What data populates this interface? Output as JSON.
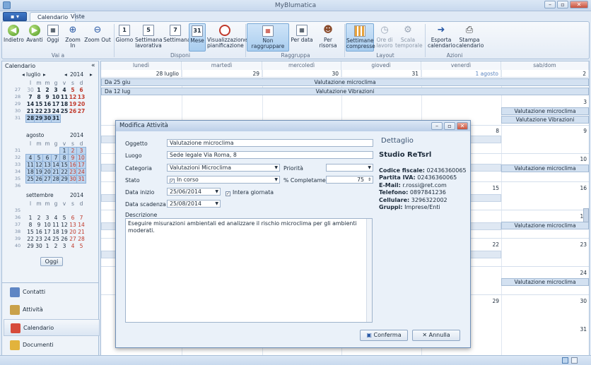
{
  "app": {
    "title": "MyBlumatica"
  },
  "tabs": {
    "file": "▪ ▾",
    "calendario": "Calendario",
    "viste": "Viste"
  },
  "ribbon": {
    "buttons": [
      {
        "label": "Indietro",
        "icon": "arrow-left-icon"
      },
      {
        "label": "Avanti",
        "icon": "arrow-right-icon"
      },
      {
        "label": "Oggi",
        "icon": "today-icon"
      },
      {
        "label": "Zoom In",
        "icon": "zoom-in-icon"
      },
      {
        "label": "Zoom Out",
        "icon": "zoom-out-icon"
      },
      {
        "label": "Giorno",
        "icon": "calendar-day-icon",
        "num": "1"
      },
      {
        "label": "Settimana lavorativa",
        "icon": "calendar-workweek-icon",
        "num": "5"
      },
      {
        "label": "Settimana",
        "icon": "calendar-week-icon",
        "num": "7"
      },
      {
        "label": "Mese",
        "icon": "calendar-month-icon",
        "num": "31"
      },
      {
        "label": "Visualizzazione pianificazione",
        "icon": "timeline-icon"
      },
      {
        "label": "Non raggruppare",
        "icon": "no-group-icon"
      },
      {
        "label": "Per data",
        "icon": "group-by-date-icon"
      },
      {
        "label": "Per risorsa",
        "icon": "group-by-resource-icon"
      },
      {
        "label": "Settimane compresse",
        "icon": "compressed-weeks-icon"
      },
      {
        "label": "Ore di lavoro",
        "icon": "work-hours-icon"
      },
      {
        "label": "Scala temporale",
        "icon": "time-scale-icon"
      },
      {
        "label": "Esporta calendario",
        "icon": "export-icon"
      },
      {
        "label": "Stampa calendario",
        "icon": "print-icon"
      }
    ],
    "groups": {
      "vai": "Vai a",
      "disponi": "Disponi",
      "raggruppa": "Raggruppa",
      "layout": "Layout",
      "azioni": "Azioni"
    }
  },
  "sidebar": {
    "title": "Calendario",
    "collapse": "«",
    "weekday_headers": [
      "l",
      "m",
      "m",
      "g",
      "v",
      "s",
      "d"
    ],
    "months": [
      {
        "name": "luglio",
        "year": "2014",
        "weeks": [
          [
            "27",
            "30",
            "1",
            "2",
            "3",
            "4",
            "5",
            "6"
          ],
          [
            "28",
            "7",
            "8",
            "9",
            "10",
            "11",
            "12",
            "13"
          ],
          [
            "29",
            "14",
            "15",
            "16",
            "17",
            "18",
            "19",
            "20"
          ],
          [
            "30",
            "21",
            "22",
            "23",
            "24",
            "25",
            "26",
            "27"
          ],
          [
            "31",
            "28",
            "29",
            "30",
            "31",
            "",
            "",
            ""
          ]
        ]
      },
      {
        "name": "agosto",
        "year": "2014",
        "weeks": [
          [
            "31",
            "",
            "",
            "",
            "",
            "1",
            "2",
            "3"
          ],
          [
            "32",
            "4",
            "5",
            "6",
            "7",
            "8",
            "9",
            "10"
          ],
          [
            "33",
            "11",
            "12",
            "13",
            "14",
            "15",
            "16",
            "17"
          ],
          [
            "34",
            "18",
            "19",
            "20",
            "21",
            "22",
            "23",
            "24"
          ],
          [
            "35",
            "25",
            "26",
            "27",
            "28",
            "29",
            "30",
            "31"
          ],
          [
            "36",
            "",
            "",
            "",
            "",
            "",
            "",
            ""
          ]
        ]
      },
      {
        "name": "settembre",
        "year": "2014",
        "weeks": [
          [
            "35",
            "",
            "",
            "",
            "",
            "",
            "",
            ""
          ],
          [
            "36",
            "1",
            "2",
            "3",
            "4",
            "5",
            "6",
            "7"
          ],
          [
            "37",
            "8",
            "9",
            "10",
            "11",
            "12",
            "13",
            "14"
          ],
          [
            "38",
            "15",
            "16",
            "17",
            "18",
            "19",
            "20",
            "21"
          ],
          [
            "39",
            "22",
            "23",
            "24",
            "25",
            "26",
            "27",
            "28"
          ],
          [
            "40",
            "29",
            "30",
            "1",
            "2",
            "3",
            "4",
            "5"
          ]
        ]
      }
    ],
    "today_button": "Oggi",
    "nav": [
      {
        "label": "Contatti",
        "icon": "contacts-icon"
      },
      {
        "label": "Attività",
        "icon": "tasks-icon"
      },
      {
        "label": "Calendario",
        "icon": "calendar-icon"
      },
      {
        "label": "Documenti",
        "icon": "documents-icon"
      }
    ]
  },
  "calendar": {
    "days": [
      "lunedì",
      "martedì",
      "mercoledì",
      "giovedì",
      "venerdì",
      "sab/dom"
    ],
    "week1_dates": [
      "28 luglio",
      "29",
      "30",
      "31",
      "1 agosto",
      "2"
    ],
    "events": [
      {
        "from": "Da 25 giu",
        "title": "Valutazione microclima"
      },
      {
        "from": "Da 12 lug",
        "title": "Valutazione Vibrazioni"
      }
    ],
    "right_dates": [
      "3",
      "8",
      "9",
      "10",
      "15",
      "16",
      "17",
      "22",
      "23",
      "24",
      "29",
      "30",
      "31"
    ],
    "event_titles": {
      "microclima": "Valutazione microclima",
      "vibrazioni": "Valutazione Vibrazioni"
    }
  },
  "dialog": {
    "title": "Modifica Attività",
    "labels": {
      "oggetto": "Oggetto",
      "luogo": "Luogo",
      "categoria": "Categoria",
      "priorita": "Priorità",
      "stato": "Stato",
      "completamento": "% Completamento",
      "inizio": "Data inizio",
      "intera": "Intera giornata",
      "scadenza": "Data scadenza",
      "descrizione": "Descrizione"
    },
    "values": {
      "oggetto": "Valutazione microclima",
      "luogo": "Sede legale Via Roma, 8",
      "categoria": "Valutazioni Microclima",
      "priorita": "",
      "stato": "In corso",
      "completamento": "75",
      "inizio": "25/06/2014",
      "scadenza": "25/08/2014",
      "descrizione": "Eseguire misurazioni ambientali ed analizzare il rischio microclima per gli ambienti moderati."
    },
    "detail": {
      "heading": "Dettaglio",
      "company": "Studio ReTsrl",
      "rows": [
        {
          "k": "Codice fiscale:",
          "v": "02436360065"
        },
        {
          "k": "Partita IVA:",
          "v": "02436360065"
        },
        {
          "k": "E-Mail:",
          "v": "r.rossi@ret.com"
        },
        {
          "k": "Telefono:",
          "v": "0897841236"
        },
        {
          "k": "Cellulare:",
          "v": "3296322002"
        },
        {
          "k": "Gruppi:",
          "v": "Imprese/Enti"
        }
      ]
    },
    "buttons": {
      "confirm": "Conferma",
      "cancel": "Annulla"
    }
  },
  "colors": {
    "accent": "#2a5aa6",
    "weekend": "#c0392b",
    "selected": "#bcd4ee"
  }
}
